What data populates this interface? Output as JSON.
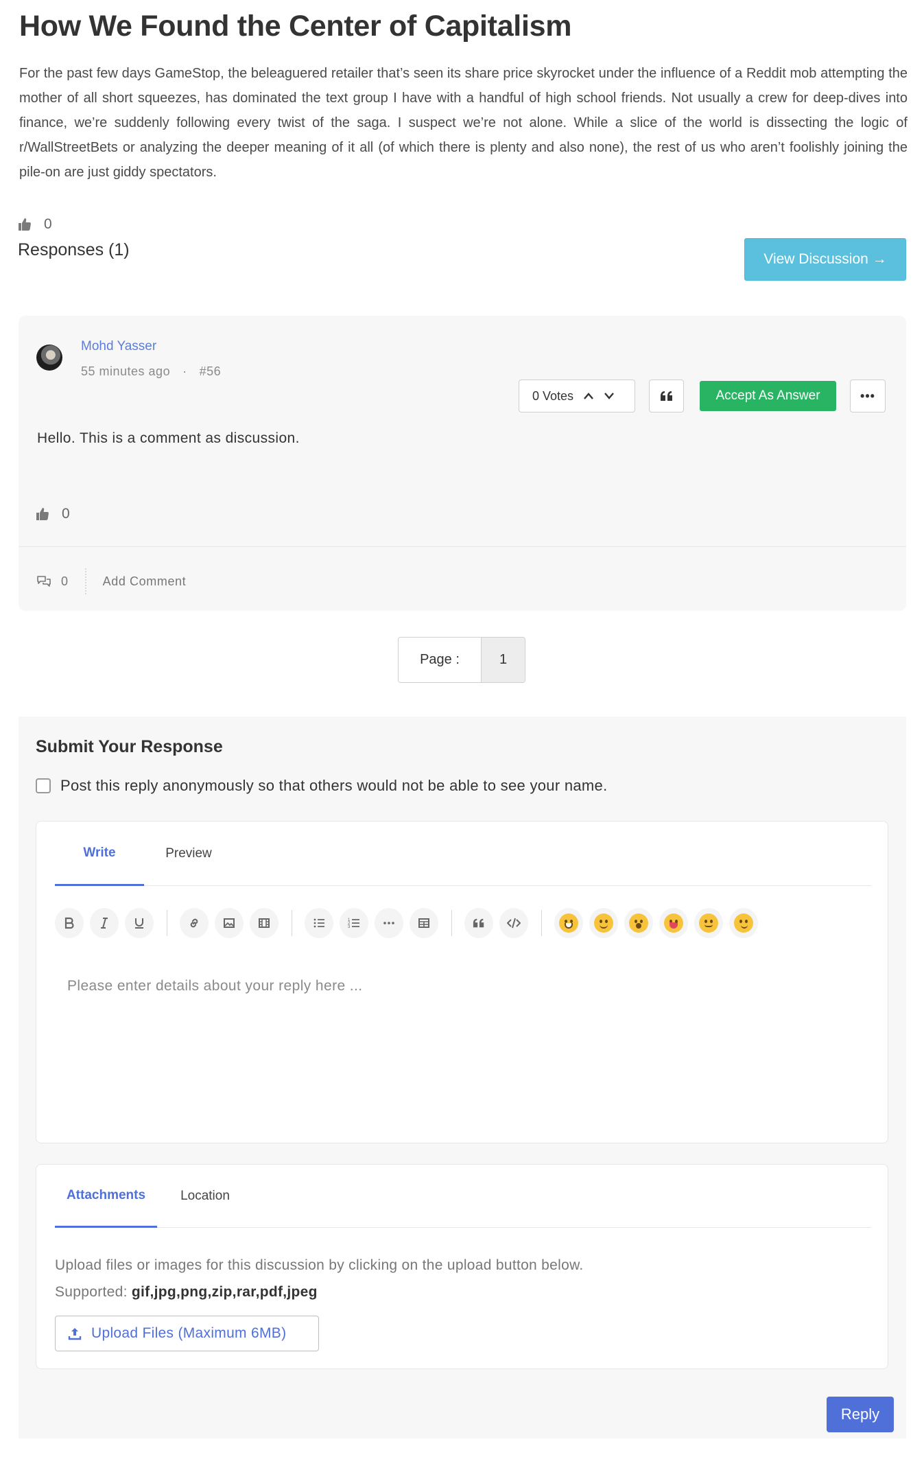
{
  "article": {
    "title": "How We Found the Center of Capitalism",
    "body": "For the past few days GameStop, the beleaguered retailer that’s seen its share price skyrocket under the influence of a Reddit mob attempting the mother of all short squeezes, has dominated the text group I have with a handful of high school friends. Not usually a crew for deep-dives into finance, we’re suddenly following every twist of the saga. I suspect we’re not alone. While a slice of the world is dissecting the logic of r/WallStreetBets or analyzing the deeper meaning of it all (of which there is plenty and also none), the rest of us who aren’t foolishly joining the pile-on are just giddy spectators.",
    "like_count": "0",
    "responses_label": "Responses (1)",
    "view_discussion_label": "View Discussion →"
  },
  "comment": {
    "author": "Mohd Yasser",
    "time_ago": "55 minutes ago",
    "separator": "·",
    "number": "#56",
    "votes_label": "0 Votes",
    "accept_label": "Accept As Answer",
    "more_label": "•••",
    "text": "Hello. This is a comment as discussion.",
    "like_count": "0",
    "comment_count": "0",
    "add_comment_label": "Add Comment"
  },
  "pagination": {
    "label": "Page :",
    "current": "1"
  },
  "submit": {
    "title": "Submit Your Response",
    "anonymous_label": "Post this reply anonymously so that others would not be able to see your name.",
    "tabs": [
      "Write",
      "Preview"
    ],
    "toolbar_icons": [
      "bold-icon",
      "italic-icon",
      "underline-icon",
      "link-icon",
      "image-icon",
      "video-icon",
      "bullet-list-icon",
      "numbered-list-icon",
      "horizontal-rule-icon",
      "table-icon",
      "blockquote-icon",
      "code-icon"
    ],
    "emojis": [
      "grinning-emoji",
      "smiling-emoji",
      "surprised-emoji",
      "tongue-emoji",
      "relieved-emoji",
      "winking-emoji"
    ],
    "placeholder": "Please enter details about your reply here ...",
    "attach_tabs": [
      "Attachments",
      "Location"
    ],
    "attach_help": "Upload files or images for this discussion by clicking on the upload button below.",
    "supported_label": "Supported:",
    "supported_types": "gif,jpg,png,zip,rar,pdf,jpeg",
    "upload_label": "Upload Files (Maximum 6MB)",
    "reply_label": "Reply"
  },
  "colors": {
    "accent": "#4f6fd9",
    "info_button": "#5bc0de",
    "success_button": "#28b463",
    "panel_bg": "#f7f7f7"
  }
}
